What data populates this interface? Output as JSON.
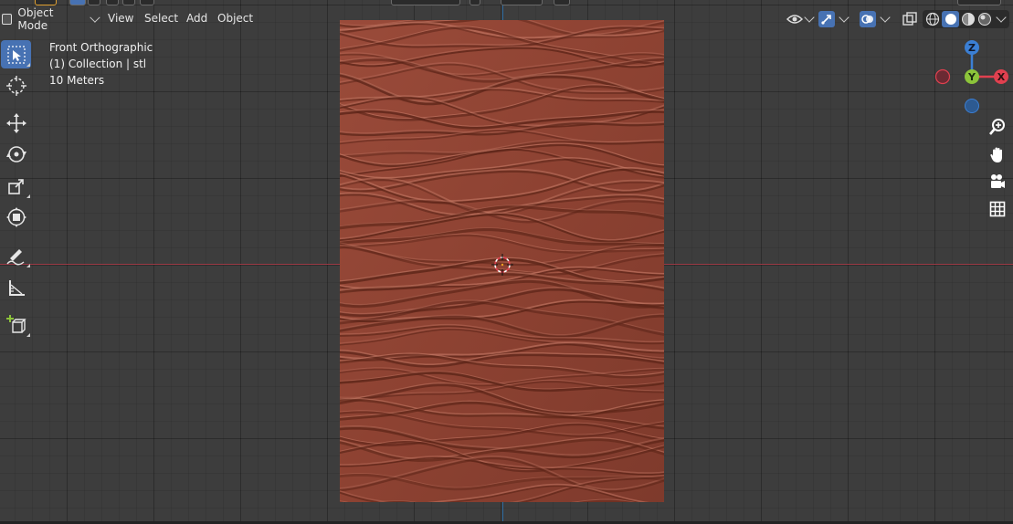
{
  "header": {
    "mode_label": "Object Mode",
    "menu": {
      "view": "View",
      "select": "Select",
      "add": "Add",
      "object": "Object"
    }
  },
  "overlay": {
    "view_name": "Front Orthographic",
    "collection": "(1) Collection | stl",
    "scale": "10 Meters"
  },
  "toolbar": {
    "active_tool": "select-box"
  },
  "gizmo": {
    "z_label": "Z",
    "y_label": "Y",
    "x_label": "X",
    "colors": {
      "x": "#e0404f",
      "y": "#8cc43a",
      "z": "#3b7fd4"
    }
  },
  "shading": {
    "active": "solid"
  },
  "colors": {
    "model": "#8f4434",
    "axis_x": "#9c3a46",
    "axis_z": "#2c6aa0",
    "active_tool": "#4772b3"
  }
}
